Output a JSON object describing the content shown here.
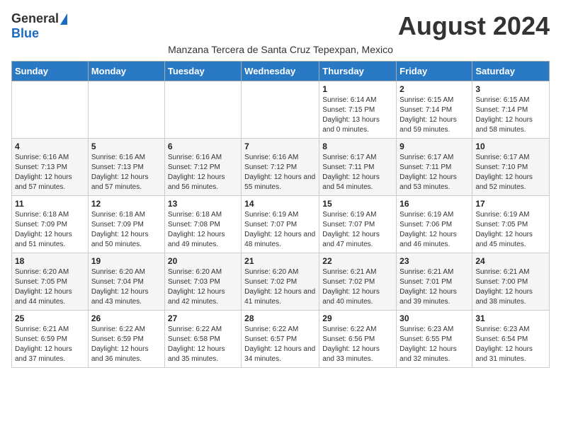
{
  "header": {
    "logo_general": "General",
    "logo_blue": "Blue",
    "month_year": "August 2024",
    "subtitle": "Manzana Tercera de Santa Cruz Tepexpan, Mexico"
  },
  "days_of_week": [
    "Sunday",
    "Monday",
    "Tuesday",
    "Wednesday",
    "Thursday",
    "Friday",
    "Saturday"
  ],
  "weeks": [
    [
      {
        "day": "",
        "info": ""
      },
      {
        "day": "",
        "info": ""
      },
      {
        "day": "",
        "info": ""
      },
      {
        "day": "",
        "info": ""
      },
      {
        "day": "1",
        "info": "Sunrise: 6:14 AM\nSunset: 7:15 PM\nDaylight: 13 hours and 0 minutes."
      },
      {
        "day": "2",
        "info": "Sunrise: 6:15 AM\nSunset: 7:14 PM\nDaylight: 12 hours and 59 minutes."
      },
      {
        "day": "3",
        "info": "Sunrise: 6:15 AM\nSunset: 7:14 PM\nDaylight: 12 hours and 58 minutes."
      }
    ],
    [
      {
        "day": "4",
        "info": "Sunrise: 6:16 AM\nSunset: 7:13 PM\nDaylight: 12 hours and 57 minutes."
      },
      {
        "day": "5",
        "info": "Sunrise: 6:16 AM\nSunset: 7:13 PM\nDaylight: 12 hours and 57 minutes."
      },
      {
        "day": "6",
        "info": "Sunrise: 6:16 AM\nSunset: 7:12 PM\nDaylight: 12 hours and 56 minutes."
      },
      {
        "day": "7",
        "info": "Sunrise: 6:16 AM\nSunset: 7:12 PM\nDaylight: 12 hours and 55 minutes."
      },
      {
        "day": "8",
        "info": "Sunrise: 6:17 AM\nSunset: 7:11 PM\nDaylight: 12 hours and 54 minutes."
      },
      {
        "day": "9",
        "info": "Sunrise: 6:17 AM\nSunset: 7:11 PM\nDaylight: 12 hours and 53 minutes."
      },
      {
        "day": "10",
        "info": "Sunrise: 6:17 AM\nSunset: 7:10 PM\nDaylight: 12 hours and 52 minutes."
      }
    ],
    [
      {
        "day": "11",
        "info": "Sunrise: 6:18 AM\nSunset: 7:09 PM\nDaylight: 12 hours and 51 minutes."
      },
      {
        "day": "12",
        "info": "Sunrise: 6:18 AM\nSunset: 7:09 PM\nDaylight: 12 hours and 50 minutes."
      },
      {
        "day": "13",
        "info": "Sunrise: 6:18 AM\nSunset: 7:08 PM\nDaylight: 12 hours and 49 minutes."
      },
      {
        "day": "14",
        "info": "Sunrise: 6:19 AM\nSunset: 7:07 PM\nDaylight: 12 hours and 48 minutes."
      },
      {
        "day": "15",
        "info": "Sunrise: 6:19 AM\nSunset: 7:07 PM\nDaylight: 12 hours and 47 minutes."
      },
      {
        "day": "16",
        "info": "Sunrise: 6:19 AM\nSunset: 7:06 PM\nDaylight: 12 hours and 46 minutes."
      },
      {
        "day": "17",
        "info": "Sunrise: 6:19 AM\nSunset: 7:05 PM\nDaylight: 12 hours and 45 minutes."
      }
    ],
    [
      {
        "day": "18",
        "info": "Sunrise: 6:20 AM\nSunset: 7:05 PM\nDaylight: 12 hours and 44 minutes."
      },
      {
        "day": "19",
        "info": "Sunrise: 6:20 AM\nSunset: 7:04 PM\nDaylight: 12 hours and 43 minutes."
      },
      {
        "day": "20",
        "info": "Sunrise: 6:20 AM\nSunset: 7:03 PM\nDaylight: 12 hours and 42 minutes."
      },
      {
        "day": "21",
        "info": "Sunrise: 6:20 AM\nSunset: 7:02 PM\nDaylight: 12 hours and 41 minutes."
      },
      {
        "day": "22",
        "info": "Sunrise: 6:21 AM\nSunset: 7:02 PM\nDaylight: 12 hours and 40 minutes."
      },
      {
        "day": "23",
        "info": "Sunrise: 6:21 AM\nSunset: 7:01 PM\nDaylight: 12 hours and 39 minutes."
      },
      {
        "day": "24",
        "info": "Sunrise: 6:21 AM\nSunset: 7:00 PM\nDaylight: 12 hours and 38 minutes."
      }
    ],
    [
      {
        "day": "25",
        "info": "Sunrise: 6:21 AM\nSunset: 6:59 PM\nDaylight: 12 hours and 37 minutes."
      },
      {
        "day": "26",
        "info": "Sunrise: 6:22 AM\nSunset: 6:59 PM\nDaylight: 12 hours and 36 minutes."
      },
      {
        "day": "27",
        "info": "Sunrise: 6:22 AM\nSunset: 6:58 PM\nDaylight: 12 hours and 35 minutes."
      },
      {
        "day": "28",
        "info": "Sunrise: 6:22 AM\nSunset: 6:57 PM\nDaylight: 12 hours and 34 minutes."
      },
      {
        "day": "29",
        "info": "Sunrise: 6:22 AM\nSunset: 6:56 PM\nDaylight: 12 hours and 33 minutes."
      },
      {
        "day": "30",
        "info": "Sunrise: 6:23 AM\nSunset: 6:55 PM\nDaylight: 12 hours and 32 minutes."
      },
      {
        "day": "31",
        "info": "Sunrise: 6:23 AM\nSunset: 6:54 PM\nDaylight: 12 hours and 31 minutes."
      }
    ]
  ]
}
